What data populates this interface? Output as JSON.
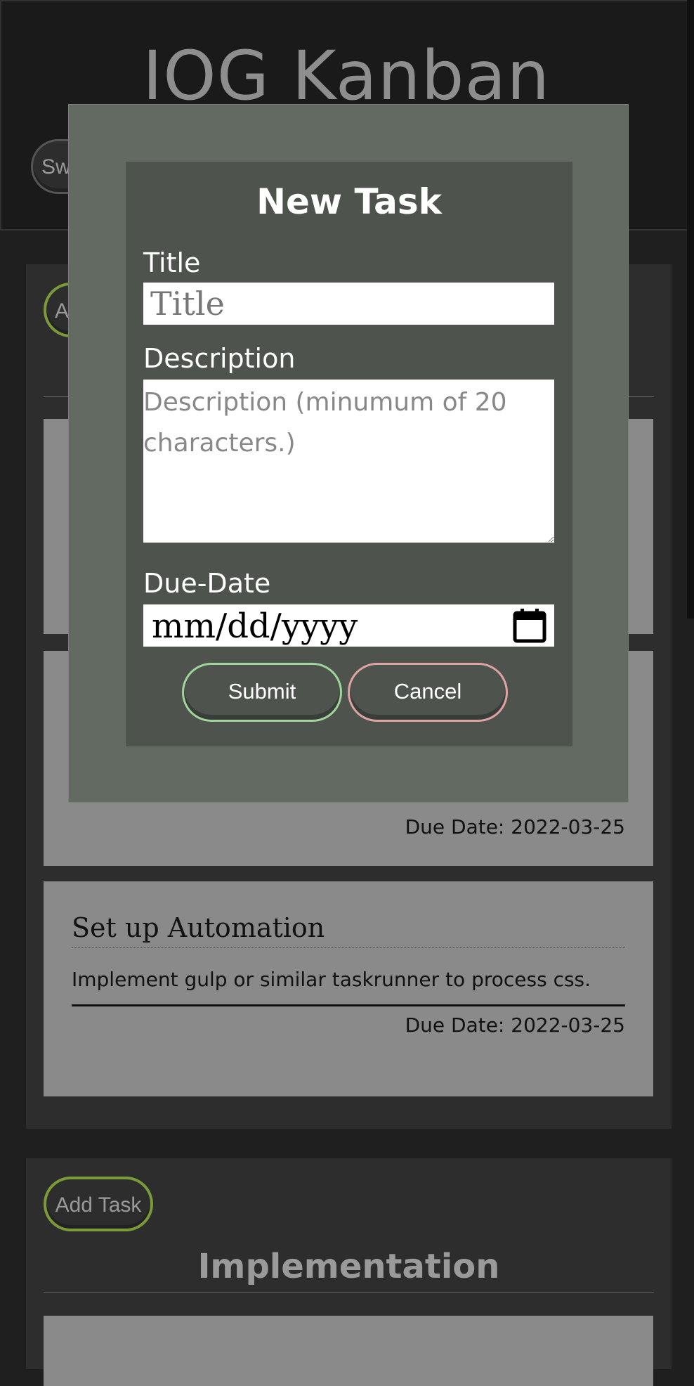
{
  "app": {
    "title": "IOG Kanban",
    "switch_label": "Sw"
  },
  "columns": [
    {
      "add_label": "A",
      "title": ""
    },
    {
      "add_label": "Add Task",
      "title": "Implementation"
    }
  ],
  "cards": [
    {
      "title": "",
      "description": "",
      "due": "Due Date: 2022-03-25"
    },
    {
      "title": "Set up Automation",
      "description": "Implement gulp or similar taskrunner to process css.",
      "due": "Due Date: 2022-03-25"
    }
  ],
  "modal": {
    "heading": "New Task",
    "title_label": "Title",
    "title_placeholder": "Title",
    "description_label": "Description",
    "description_placeholder": "Description (minumum of 20 characters.)",
    "due_label": "Due-Date",
    "due_placeholder": "mm/dd/yyyy",
    "submit_label": "Submit",
    "cancel_label": "Cancel"
  },
  "icons": {
    "calendar": "calendar-icon"
  }
}
